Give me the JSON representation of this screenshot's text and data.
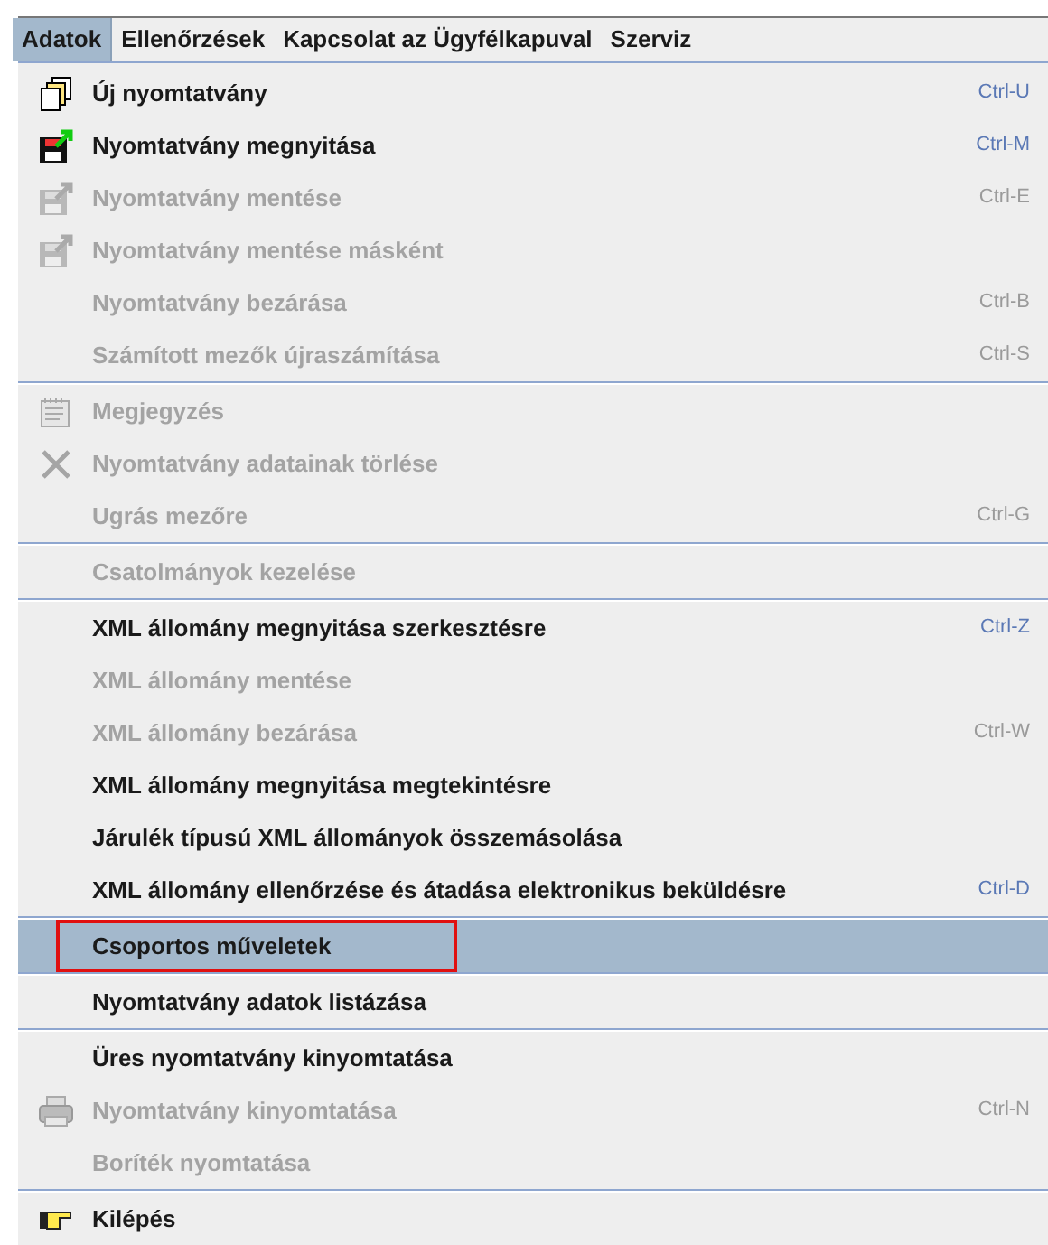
{
  "menubar": [
    {
      "label": "Adatok",
      "selected": true
    },
    {
      "label": "Ellenőrzések",
      "selected": false
    },
    {
      "label": "Kapcsolat az Ügyfélkapuval",
      "selected": false
    },
    {
      "label": "Szerviz",
      "selected": false
    }
  ],
  "menu": {
    "items": [
      {
        "kind": "item",
        "label": "Új nyomtatvány",
        "shortcut": "Ctrl-U",
        "disabled": false,
        "selected": false,
        "outlined": false
      },
      {
        "kind": "item",
        "label": "Nyomtatvány megnyitása",
        "shortcut": "Ctrl-M",
        "disabled": false,
        "selected": false,
        "outlined": false
      },
      {
        "kind": "item",
        "label": "Nyomtatvány mentése",
        "shortcut": "Ctrl-E",
        "disabled": true,
        "selected": false,
        "outlined": false
      },
      {
        "kind": "item",
        "label": "Nyomtatvány mentése másként",
        "disabled": true,
        "selected": false,
        "outlined": false
      },
      {
        "kind": "item",
        "label": "Nyomtatvány bezárása",
        "shortcut": "Ctrl-B",
        "disabled": true,
        "selected": false,
        "outlined": false
      },
      {
        "kind": "item",
        "label": "Számított mezők újraszámítása",
        "shortcut": "Ctrl-S",
        "disabled": true,
        "selected": false,
        "outlined": false
      },
      {
        "kind": "separator"
      },
      {
        "kind": "item",
        "label": "Megjegyzés",
        "disabled": true,
        "selected": false,
        "outlined": false
      },
      {
        "kind": "item",
        "label": "Nyomtatvány adatainak törlése",
        "disabled": true,
        "selected": false,
        "outlined": false
      },
      {
        "kind": "item",
        "label": "Ugrás mezőre",
        "shortcut": "Ctrl-G",
        "disabled": true,
        "selected": false,
        "outlined": false
      },
      {
        "kind": "separator"
      },
      {
        "kind": "item",
        "label": "Csatolmányok kezelése",
        "disabled": true,
        "selected": false,
        "outlined": false
      },
      {
        "kind": "separator"
      },
      {
        "kind": "item",
        "label": "XML állomány megnyitása szerkesztésre",
        "shortcut": "Ctrl-Z",
        "disabled": false,
        "selected": false,
        "outlined": false
      },
      {
        "kind": "item",
        "label": "XML állomány mentése",
        "disabled": true,
        "selected": false,
        "outlined": false
      },
      {
        "kind": "item",
        "label": "XML állomány bezárása",
        "shortcut": "Ctrl-W",
        "disabled": true,
        "selected": false,
        "outlined": false
      },
      {
        "kind": "item",
        "label": "XML állomány megnyitása megtekintésre",
        "disabled": false,
        "selected": false,
        "outlined": false
      },
      {
        "kind": "item",
        "label": "Járulék típusú XML állományok összemásolása",
        "disabled": false,
        "selected": false,
        "outlined": false
      },
      {
        "kind": "item",
        "label": "XML állomány ellenőrzése és átadása elektronikus beküldésre",
        "shortcut": "Ctrl-D",
        "disabled": false,
        "selected": false,
        "outlined": false
      },
      {
        "kind": "separator"
      },
      {
        "kind": "item",
        "label": "Csoportos műveletek",
        "disabled": false,
        "selected": true,
        "outlined": true
      },
      {
        "kind": "separator"
      },
      {
        "kind": "item",
        "label": "Nyomtatvány adatok listázása",
        "disabled": false,
        "selected": false,
        "outlined": false
      },
      {
        "kind": "separator"
      },
      {
        "kind": "item",
        "label": "Üres nyomtatvány kinyomtatása",
        "disabled": false,
        "selected": false,
        "outlined": false
      },
      {
        "kind": "item",
        "label": "Nyomtatvány kinyomtatása",
        "shortcut": "Ctrl-N",
        "disabled": true,
        "selected": false,
        "outlined": false
      },
      {
        "kind": "item",
        "label": "Boríték nyomtatása",
        "disabled": true,
        "selected": false,
        "outlined": false
      },
      {
        "kind": "separator"
      },
      {
        "kind": "item",
        "label": "Kilépés",
        "disabled": false,
        "selected": false,
        "outlined": false
      }
    ]
  }
}
